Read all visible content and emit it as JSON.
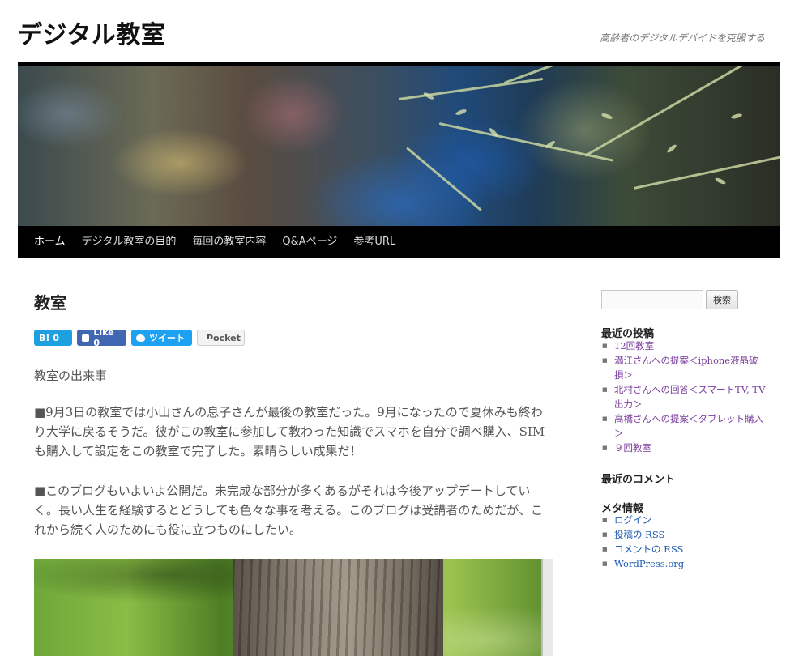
{
  "site": {
    "title": "デジタル教室",
    "description": "高齢者のデジタルデバイドを克服する"
  },
  "nav": {
    "items": [
      "ホーム",
      "デジタル教室の目的",
      "毎回の教室内容",
      "Q&Aページ",
      "参考URL"
    ]
  },
  "post": {
    "title": "教室",
    "share": {
      "hatena": "B! 0",
      "like": "Like 0",
      "tweet": "ツイート",
      "pocket": "Pocket"
    },
    "lead": "教室の出来事",
    "paragraphs": [
      "■9月3日の教室では小山さんの息子さんが最後の教室だった。9月になったので夏休みも終わり大学に戻るそうだ。彼がこの教室に参加して教わった知識でスマホを自分で調べ購入、SIMも購入して設定をこの教室で完了した。素晴らしい成果だ！",
      "■このブログもいよいよ公開だ。未完成な部分が多くあるがそれは今後アップデートしていく。長い人生を経験するとどうしても色々な事を考える。このブログは受講者のためだが、これから続く人のためにも役に立つものにしたい。"
    ]
  },
  "sidebar": {
    "search": {
      "placeholder": "",
      "button": "検索"
    },
    "recent_posts": {
      "title": "最近の投稿",
      "items": [
        "12回教室",
        "満江さんへの提案＜iphone液晶破損＞",
        "北村さんへの回答＜スマートTV, TV出力＞",
        "高橋さんへの提案＜タブレット購入＞",
        "９回教室"
      ]
    },
    "recent_comments": {
      "title": "最近のコメント"
    },
    "meta": {
      "title": "メタ情報",
      "items": [
        "ログイン",
        "投稿の RSS",
        "コメントの RSS",
        "WordPress.org"
      ]
    }
  },
  "colors": {
    "nav_bg": "#000000",
    "link_visited": "#7a3e9d",
    "link": "#1b57b1",
    "hatena": "#1e9fe0",
    "facebook": "#4267b2",
    "twitter": "#1da1f2",
    "pocket": "#ef4056"
  }
}
